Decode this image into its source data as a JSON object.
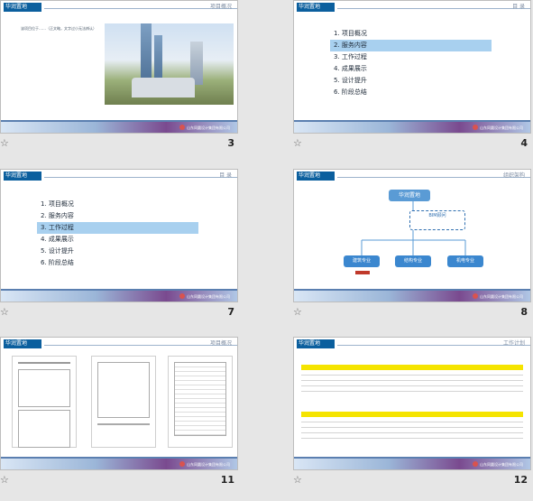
{
  "slides": [
    {
      "number": "3",
      "header": "项目概况",
      "logo": "华润置地",
      "text": "该项目位于……（正文略，文字过小无法辨认）"
    },
    {
      "number": "4",
      "header": "目 录",
      "logo": "华润置地",
      "agenda": [
        "1. 项目概况",
        "2. 服务内容",
        "3. 工作过程",
        "4. 成果展示",
        "5. 设计提升",
        "6. 阶段总结"
      ],
      "highlight": "2"
    },
    {
      "number": "7",
      "header": "目 录",
      "logo": "华润置地",
      "agenda": [
        "1. 项目概况",
        "2. 服务内容",
        "3. 工作过程",
        "4. 成果展示",
        "5. 设计提升",
        "6. 阶段总结"
      ],
      "highlight": "3"
    },
    {
      "number": "8",
      "header": "组织架构",
      "logo": "华润置地",
      "org": {
        "top": "华润置地",
        "mid": "BIM顾问",
        "children": [
          "建筑专业",
          "结构专业",
          "机电专业"
        ]
      }
    },
    {
      "number": "11",
      "header": "项目概况",
      "logo": "华润置地"
    },
    {
      "number": "12",
      "header": "工作计划",
      "logo": "华润置地"
    }
  ],
  "footer_company": "山东同圆设计集团有限公司",
  "star_glyph": "☆",
  "colors": {
    "accent": "#0b5f9e",
    "highlight": "#a8d0ef",
    "selected_outline": "#f0b030",
    "table_head": "#f5e400"
  }
}
